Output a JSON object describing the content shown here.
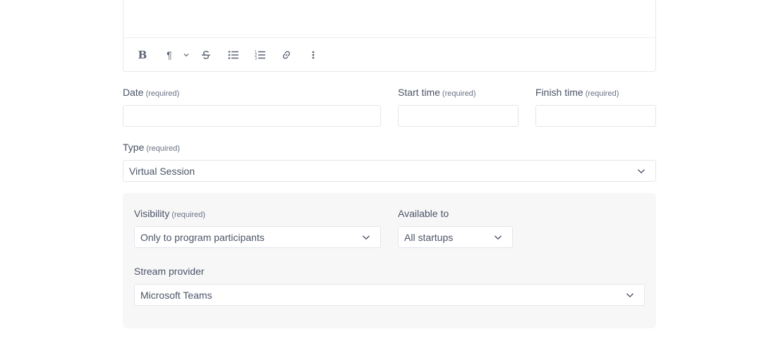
{
  "editor": {
    "toolbar": [
      {
        "name": "bold-button",
        "glyph": "B"
      },
      {
        "name": "paragraph-button",
        "glyph": "¶"
      },
      {
        "name": "strikethrough-button",
        "glyph": "S"
      },
      {
        "name": "bullet-list-button",
        "glyph": "bullet-list-icon"
      },
      {
        "name": "numbered-list-button",
        "glyph": "numbered-list-icon"
      },
      {
        "name": "link-button",
        "glyph": "link-icon"
      },
      {
        "name": "more-button",
        "glyph": "more-vertical-icon"
      }
    ]
  },
  "form": {
    "date": {
      "label": "Date",
      "required": "(required)",
      "value": ""
    },
    "start_time": {
      "label": "Start time",
      "required": "(required)",
      "value": ""
    },
    "finish_time": {
      "label": "Finish time",
      "required": "(required)",
      "value": ""
    },
    "type": {
      "label": "Type",
      "required": "(required)",
      "value": "Virtual Session"
    },
    "visibility": {
      "label": "Visibility",
      "required": "(required)",
      "value": "Only to program participants"
    },
    "available_to": {
      "label": "Available to",
      "value": "All startups"
    },
    "stream_provider": {
      "label": "Stream provider",
      "value": "Microsoft Teams"
    }
  }
}
